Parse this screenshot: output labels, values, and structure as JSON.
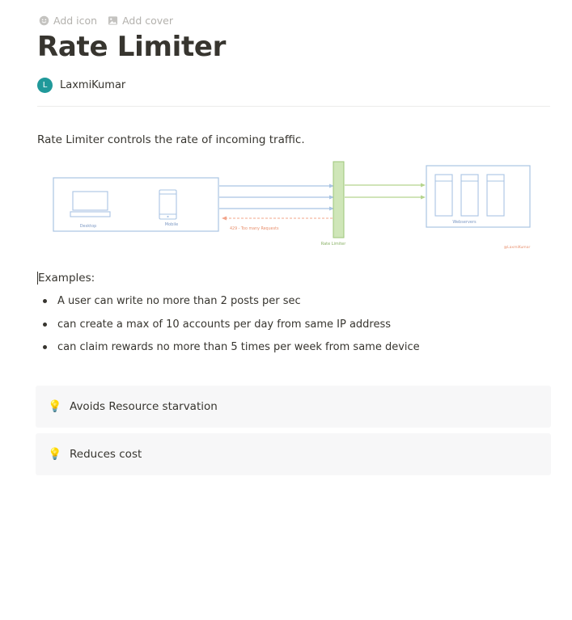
{
  "top_actions": {
    "add_icon": "Add icon",
    "add_cover": "Add cover"
  },
  "page": {
    "title": "Rate Limiter"
  },
  "author": {
    "avatar_initial": "L",
    "name": "LaxmiKumar",
    "avatar_color": "#20999a"
  },
  "content": {
    "intro": "Rate Limiter controls the rate of incoming traffic.",
    "examples_label": "Examples:",
    "examples": [
      "A user can write no more than 2 posts per sec",
      "can create a max of 10 accounts per day from same IP address",
      "can claim rewards no more than 5 times per week from same device"
    ]
  },
  "diagram": {
    "client_labels": [
      "Desktop",
      "Mobile"
    ],
    "limiter_label": "Rate Limiter",
    "server_label": "Webservers",
    "reject_label": "429 - Too many Requests",
    "signature": "@LaxmiKumar",
    "colors": {
      "box": "#a9c4e3",
      "limiter": "#cfe6b8",
      "allowed": "#b5d48e",
      "rejected": "#f2a48a"
    }
  },
  "callouts": [
    {
      "icon": "lightbulb-icon",
      "text": "Avoids Resource starvation"
    },
    {
      "icon": "lightbulb-icon",
      "text": "Reduces cost"
    }
  ]
}
